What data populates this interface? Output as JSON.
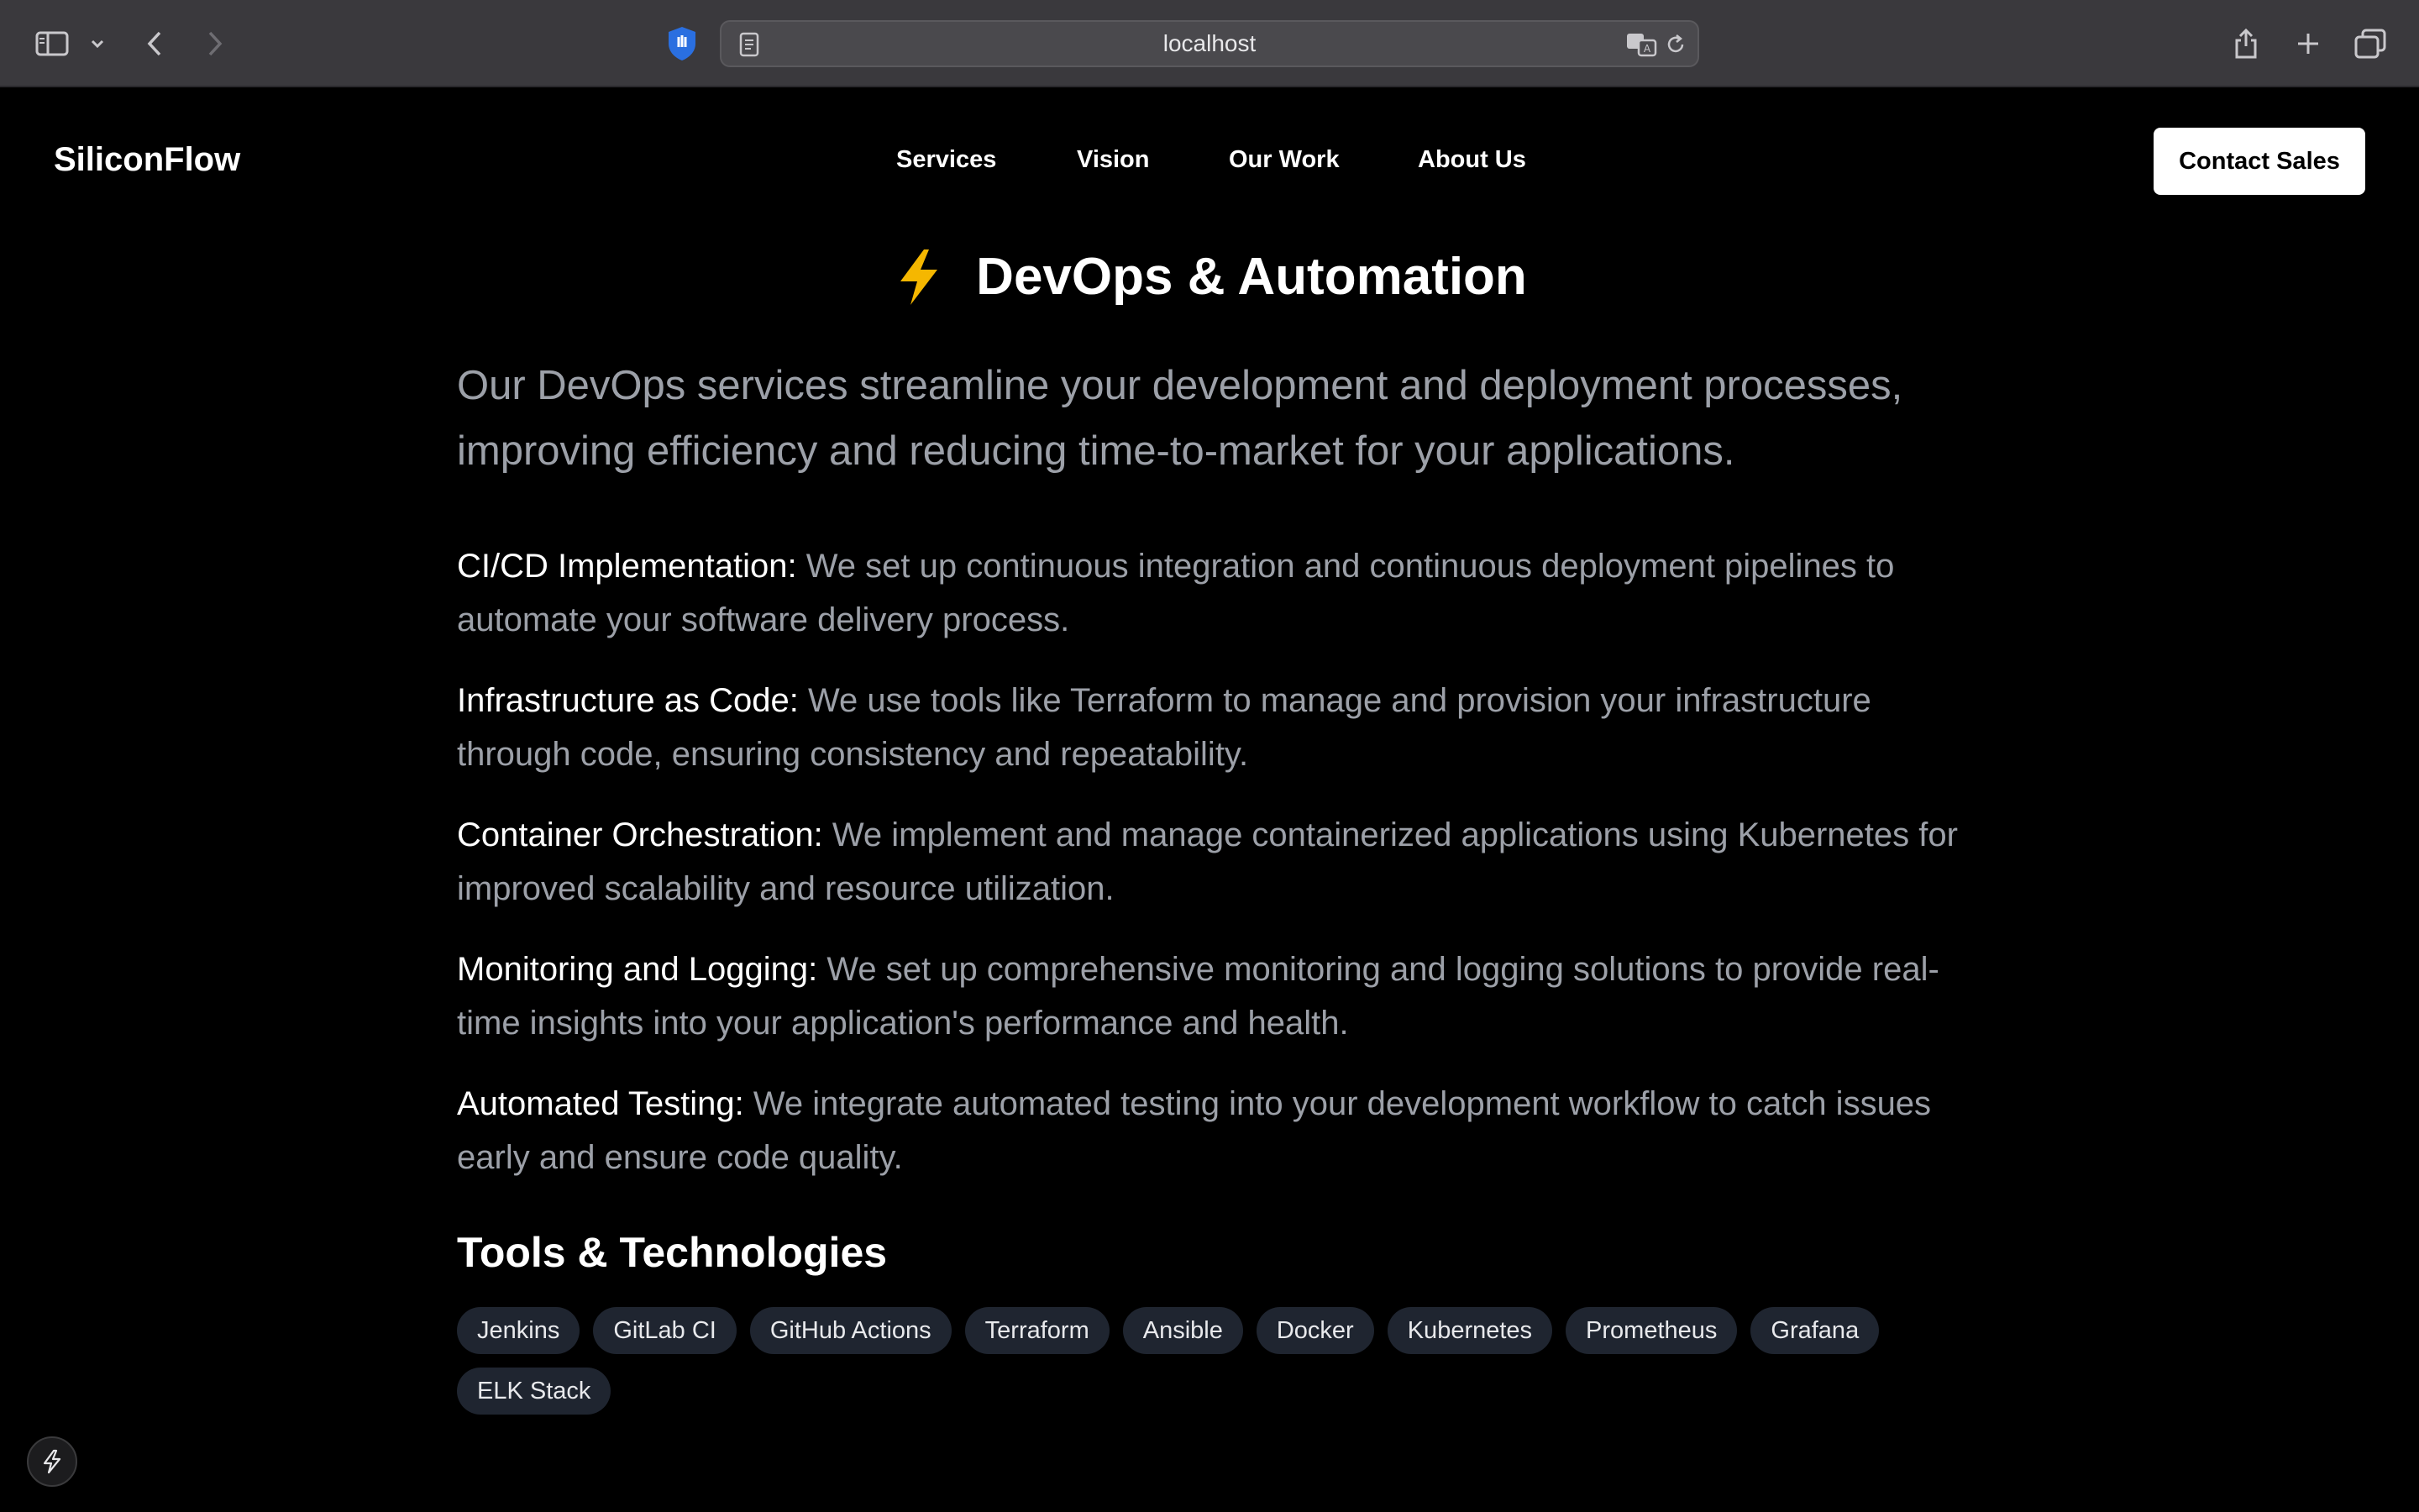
{
  "browser": {
    "url": "localhost",
    "icons": [
      "sidebar-icon",
      "chevron-down-icon",
      "back-icon",
      "forward-icon",
      "shield-icon",
      "reader-icon",
      "translate-icon",
      "reload-icon",
      "share-icon",
      "new-tab-icon",
      "tabs-overview-icon"
    ]
  },
  "header": {
    "logo": "SiliconFlow",
    "nav": [
      "Services",
      "Vision",
      "Our Work",
      "About Us"
    ],
    "cta": "Contact Sales"
  },
  "main": {
    "title": "DevOps & Automation",
    "title_icon": "lightning-bolt-icon",
    "intro": "Our DevOps services streamline your development and deployment processes, improving efficiency and reducing time-to-market for your applications.",
    "features": [
      {
        "title": "CI/CD Implementation:",
        "text": "We set up continuous integration and continuous deployment pipelines to automate your software delivery process."
      },
      {
        "title": "Infrastructure as Code:",
        "text": "We use tools like Terraform to manage and provision your infrastructure through code, ensuring consistency and repeatability."
      },
      {
        "title": "Container Orchestration:",
        "text": "We implement and manage containerized applications using Kubernetes for improved scalability and resource utilization."
      },
      {
        "title": "Monitoring and Logging:",
        "text": "We set up comprehensive monitoring and logging solutions to provide real-time insights into your application's performance and health."
      },
      {
        "title": "Automated Testing:",
        "text": "We integrate automated testing into your development workflow to catch issues early and ensure code quality."
      }
    ],
    "tools_heading": "Tools & Technologies",
    "tools": [
      "Jenkins",
      "GitLab CI",
      "GitHub Actions",
      "Terraform",
      "Ansible",
      "Docker",
      "Kubernetes",
      "Prometheus",
      "Grafana",
      "ELK Stack"
    ]
  },
  "colors": {
    "background": "#000000",
    "chrome": "#3a393d",
    "body_text": "#9ca0a8",
    "tag_bg": "#1f2530",
    "bolt": "#f5b700"
  }
}
